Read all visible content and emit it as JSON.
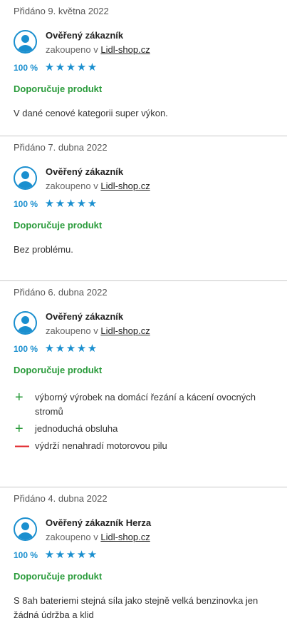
{
  "reviews": [
    {
      "date": "Přidáno 9. května 2022",
      "author": "Ověřený zákazník",
      "bought_prefix": "zakoupeno v",
      "shop": "Lidl-shop.cz",
      "percent": "100 %",
      "stars": 5,
      "recommend": "Doporučuje produkt",
      "text": "V dané cenové kategorii super výkon."
    },
    {
      "date": "Přidáno 7. dubna 2022",
      "author": "Ověřený zákazník",
      "bought_prefix": "zakoupeno v",
      "shop": "Lidl-shop.cz",
      "percent": "100 %",
      "stars": 5,
      "recommend": "Doporučuje produkt",
      "text": "Bez problému."
    },
    {
      "date": "Přidáno 6. dubna 2022",
      "author": "Ověřený zákazník",
      "bought_prefix": "zakoupeno v",
      "shop": "Lidl-shop.cz",
      "percent": "100 %",
      "stars": 5,
      "recommend": "Doporučuje produkt",
      "pros": [
        "výborný výrobek na domácí řezání a kácení ovocných stromů",
        "jednoduchá obsluha"
      ],
      "cons": [
        "výdrží nenahradí motorovou pilu"
      ],
      "plus_symbol": "+",
      "minus_symbol": "—"
    },
    {
      "date": "Přidáno 4. dubna 2022",
      "author": "Ověřený zákazník Herza",
      "bought_prefix": "zakoupeno v",
      "shop": "Lidl-shop.cz",
      "percent": "100 %",
      "stars": 5,
      "recommend": "Doporučuje produkt",
      "text": "S 8ah bateriemi stejná síla jako stejně velká benzinovka jen žádná údržba a klid"
    }
  ],
  "star_glyph": "★",
  "icons": {
    "avatar": "user-avatar-icon",
    "star": "star-icon",
    "plus": "plus-icon",
    "minus": "minus-icon"
  },
  "colors": {
    "accent": "#1a8fcf",
    "recommend": "#2a9b3b",
    "minus": "#e0262a"
  }
}
